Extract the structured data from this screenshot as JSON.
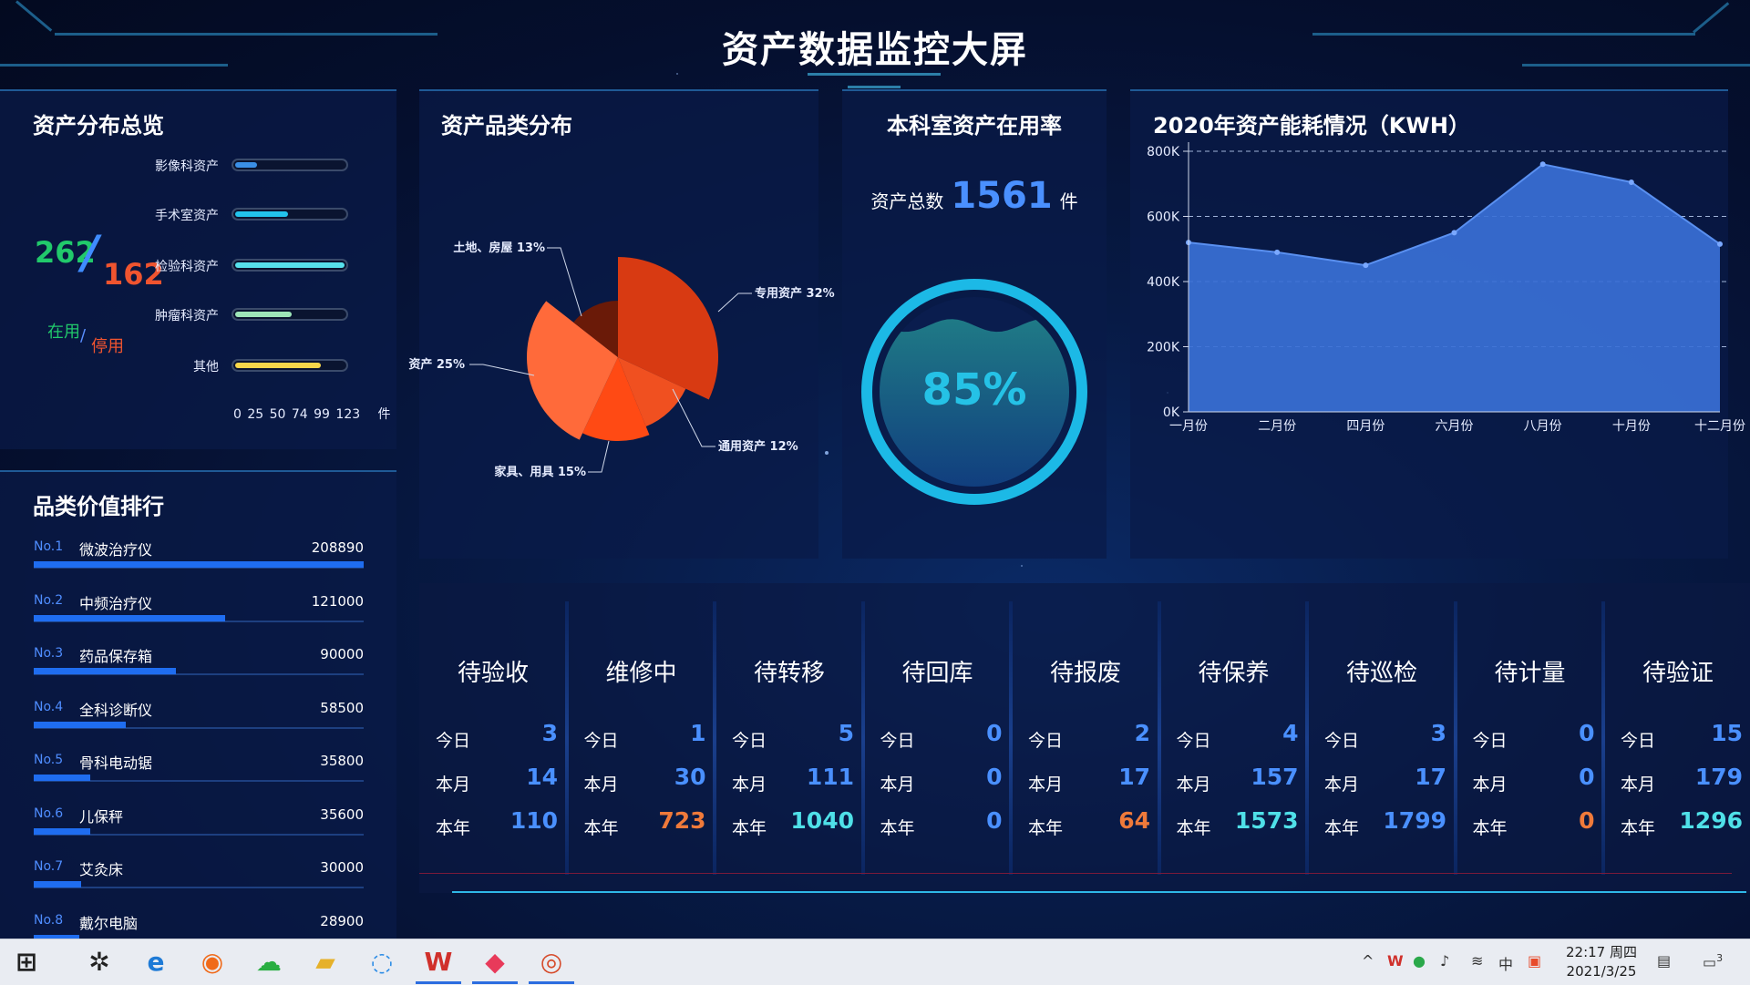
{
  "title": "资产数据监控大屏",
  "distribution": {
    "title": "资产分布总览",
    "in_use": "262",
    "stopped": "162",
    "in_use_label": "在用",
    "stopped_label": "停用",
    "slash": "/",
    "bars": [
      {
        "label": "影像科资产",
        "value": 25,
        "color": "#3a8fe6"
      },
      {
        "label": "手术室资产",
        "value": 59,
        "color": "#22c3ec"
      },
      {
        "label": "检验科资产",
        "value": 123,
        "color": "#56e0ec"
      },
      {
        "label": "肿瘤科资产",
        "value": 64,
        "color": "#9ee6b8"
      },
      {
        "label": "其他",
        "value": 96,
        "color": "#f7d64a"
      }
    ],
    "axis_ticks": "0 25 50 74 99 123",
    "axis_unit": "件"
  },
  "ranking": {
    "title": "品类价值排行",
    "items": [
      {
        "no": "No.1",
        "name": "微波治疗仪",
        "value": "208890",
        "num": 208890
      },
      {
        "no": "No.2",
        "name": "中频治疗仪",
        "value": "121000",
        "num": 121000
      },
      {
        "no": "No.3",
        "name": "药品保存箱",
        "value": "90000",
        "num": 90000
      },
      {
        "no": "No.4",
        "name": "全科诊断仪",
        "value": "58500",
        "num": 58500
      },
      {
        "no": "No.5",
        "name": "骨科电动锯",
        "value": "35800",
        "num": 35800
      },
      {
        "no": "No.6",
        "name": "儿保秤",
        "value": "35600",
        "num": 35600
      },
      {
        "no": "No.7",
        "name": "艾灸床",
        "value": "30000",
        "num": 30000
      },
      {
        "no": "No.8",
        "name": "戴尔电脑",
        "value": "28900",
        "num": 28900
      }
    ]
  },
  "category": {
    "title": "资产品类分布",
    "slices": [
      {
        "label": "专用资产 32%",
        "percent": 32,
        "color": "#d83a12"
      },
      {
        "label": "通用资产 12%",
        "percent": 12,
        "color": "#f05020"
      },
      {
        "label": "家具、用具 15%",
        "percent": 15,
        "color": "#ff4a14"
      },
      {
        "label": "资产 25%",
        "percent": 25,
        "color": "#ff6a3a"
      },
      {
        "label": "土地、房屋 13%",
        "percent": 13,
        "color": "#6a1a08"
      }
    ]
  },
  "usage": {
    "title": "本科室资产在用率",
    "total_prefix": "资产总数",
    "total": "1561",
    "total_unit": "件",
    "percent_text": "85%",
    "percent": 85
  },
  "chart_data": {
    "type": "area",
    "title": "2020年资产能耗情况（KWH）",
    "x": [
      "一月份",
      "二月份",
      "四月份",
      "六月份",
      "八月份",
      "十月份",
      "十二月份"
    ],
    "series": [
      {
        "values": [
          520000,
          490000,
          450000,
          550000,
          760000,
          705000,
          515000
        ]
      }
    ],
    "ylim": [
      0,
      800000
    ],
    "yticks": [
      "0K",
      "200K",
      "400K",
      "600K",
      "800K"
    ],
    "grid": true,
    "color": "#3a70d6"
  },
  "status": {
    "row_labels": [
      "今日",
      "本月",
      "本年"
    ],
    "columns": [
      {
        "title": "待验收",
        "today": "3",
        "month": "14",
        "year": "110",
        "year_color": "#4a90ff"
      },
      {
        "title": "维修中",
        "today": "1",
        "month": "30",
        "year": "723",
        "year_color": "#f07a3a"
      },
      {
        "title": "待转移",
        "today": "5",
        "month": "111",
        "year": "1040",
        "year_color": "#4fe0e8"
      },
      {
        "title": "待回库",
        "today": "0",
        "month": "0",
        "year": "0",
        "year_color": "#4a90ff"
      },
      {
        "title": "待报废",
        "today": "2",
        "month": "17",
        "year": "64",
        "year_color": "#f07a3a"
      },
      {
        "title": "待保养",
        "today": "4",
        "month": "157",
        "year": "1573",
        "year_color": "#4fe0e8"
      },
      {
        "title": "待巡检",
        "today": "3",
        "month": "17",
        "year": "1799",
        "year_color": "#4a90ff"
      },
      {
        "title": "待计量",
        "today": "0",
        "month": "0",
        "year": "0",
        "year_color": "#f07a3a"
      },
      {
        "title": "待验证",
        "today": "15",
        "month": "179",
        "year": "1296",
        "year_color": "#4fe0e8"
      }
    ]
  },
  "taskbar": {
    "clock_time": "22:17 周四",
    "clock_date": "2021/3/25",
    "ime": "中",
    "notify_count": "3",
    "apps": [
      "start-icon",
      "app-icon",
      "ie-icon",
      "firefox-icon",
      "wechat-icon",
      "folder-icon",
      "search-app-icon",
      "wps-icon",
      "paint-icon",
      "chrome-icon"
    ]
  }
}
